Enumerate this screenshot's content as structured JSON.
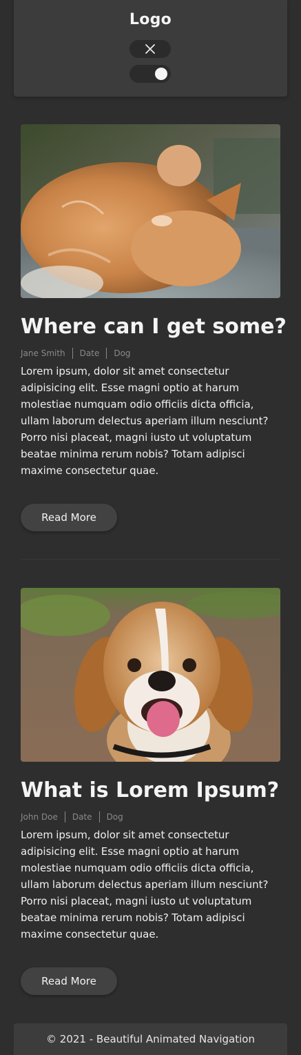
{
  "header": {
    "logo": "Logo",
    "close_icon": "close-icon",
    "toggle_state": "on"
  },
  "posts": [
    {
      "image_subject": "orange tabby cat lying on its side",
      "title": "Where can I get some?",
      "author": "Jane Smith",
      "date": "Date",
      "category": "Dog",
      "body": "Lorem ipsum, dolor sit amet consectetur adipisicing elit. Esse magni optio at harum molestiae numquam odio officiis dicta officia, ullam laborum delectus aperiam illum nesciunt? Porro nisi placeat, magni iusto ut voluptatum beatae minima rerum nobis? Totam adipisci maxime consectetur quae.",
      "button": "Read More"
    },
    {
      "image_subject": "smiling beagle puppy",
      "title": "What is Lorem Ipsum?",
      "author": "John Doe",
      "date": "Date",
      "category": "Dog",
      "body": "Lorem ipsum, dolor sit amet consectetur adipisicing elit. Esse magni optio at harum molestiae numquam odio officiis dicta officia, ullam laborum delectus aperiam illum nesciunt? Porro nisi placeat, magni iusto ut voluptatum beatae minima rerum nobis? Totam adipisci maxime consectetur quae.",
      "button": "Read More"
    }
  ],
  "footer": {
    "text": "© 2021 - Beautiful Animated Navigation"
  },
  "colors": {
    "background": "#2e2e2e",
    "panel": "#3c3c3c",
    "button": "#424242",
    "meta_text": "#8a8a8a"
  }
}
